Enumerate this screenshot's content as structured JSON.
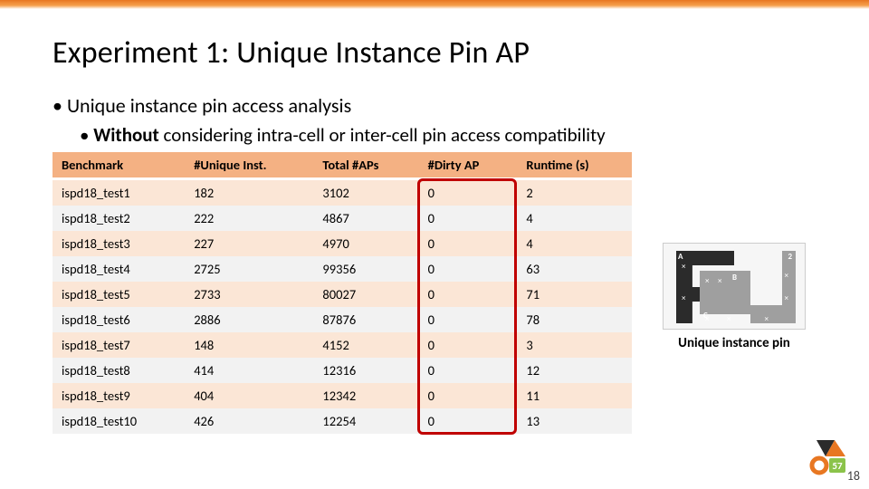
{
  "title": "Experiment 1: Unique Instance Pin AP",
  "bullet1": "Unique instance pin access analysis",
  "bullet2_bold": "Without",
  "bullet2_rest": " considering intra-cell or inter-cell pin access compatibility",
  "table": {
    "headers": [
      "Benchmark",
      "#Unique Inst.",
      "Total #APs",
      "#Dirty AP",
      "Runtime (s)"
    ],
    "rows": [
      [
        "ispd18_test1",
        "182",
        "3102",
        "0",
        "2"
      ],
      [
        "ispd18_test2",
        "222",
        "4867",
        "0",
        "4"
      ],
      [
        "ispd18_test3",
        "227",
        "4970",
        "0",
        "4"
      ],
      [
        "ispd18_test4",
        "2725",
        "99356",
        "0",
        "63"
      ],
      [
        "ispd18_test5",
        "2733",
        "80027",
        "0",
        "71"
      ],
      [
        "ispd18_test6",
        "2886",
        "87876",
        "0",
        "78"
      ],
      [
        "ispd18_test7",
        "148",
        "4152",
        "0",
        "3"
      ],
      [
        "ispd18_test8",
        "414",
        "12316",
        "0",
        "12"
      ],
      [
        "ispd18_test9",
        "404",
        "12342",
        "0",
        "11"
      ],
      [
        "ispd18_test10",
        "426",
        "12254",
        "0",
        "13"
      ]
    ]
  },
  "caption": "Unique instance pin",
  "logo_text": "57",
  "page_number": "18",
  "chart_data": {
    "type": "table",
    "title": "Experiment 1: Unique Instance Pin AP",
    "columns": [
      "Benchmark",
      "#Unique Inst.",
      "Total #APs",
      "#Dirty AP",
      "Runtime (s)"
    ],
    "rows": [
      {
        "Benchmark": "ispd18_test1",
        "#Unique Inst.": 182,
        "Total #APs": 3102,
        "#Dirty AP": 0,
        "Runtime (s)": 2
      },
      {
        "Benchmark": "ispd18_test2",
        "#Unique Inst.": 222,
        "Total #APs": 4867,
        "#Dirty AP": 0,
        "Runtime (s)": 4
      },
      {
        "Benchmark": "ispd18_test3",
        "#Unique Inst.": 227,
        "Total #APs": 4970,
        "#Dirty AP": 0,
        "Runtime (s)": 4
      },
      {
        "Benchmark": "ispd18_test4",
        "#Unique Inst.": 2725,
        "Total #APs": 99356,
        "#Dirty AP": 0,
        "Runtime (s)": 63
      },
      {
        "Benchmark": "ispd18_test5",
        "#Unique Inst.": 2733,
        "Total #APs": 80027,
        "#Dirty AP": 0,
        "Runtime (s)": 71
      },
      {
        "Benchmark": "ispd18_test6",
        "#Unique Inst.": 2886,
        "Total #APs": 87876,
        "#Dirty AP": 0,
        "Runtime (s)": 78
      },
      {
        "Benchmark": "ispd18_test7",
        "#Unique Inst.": 148,
        "Total #APs": 4152,
        "#Dirty AP": 0,
        "Runtime (s)": 3
      },
      {
        "Benchmark": "ispd18_test8",
        "#Unique Inst.": 414,
        "Total #APs": 12316,
        "#Dirty AP": 0,
        "Runtime (s)": 12
      },
      {
        "Benchmark": "ispd18_test9",
        "#Unique Inst.": 404,
        "Total #APs": 12342,
        "#Dirty AP": 0,
        "Runtime (s)": 11
      },
      {
        "Benchmark": "ispd18_test10",
        "#Unique Inst.": 426,
        "Total #APs": 12254,
        "#Dirty AP": 0,
        "Runtime (s)": 13
      }
    ],
    "highlighted_column": "#Dirty AP"
  }
}
